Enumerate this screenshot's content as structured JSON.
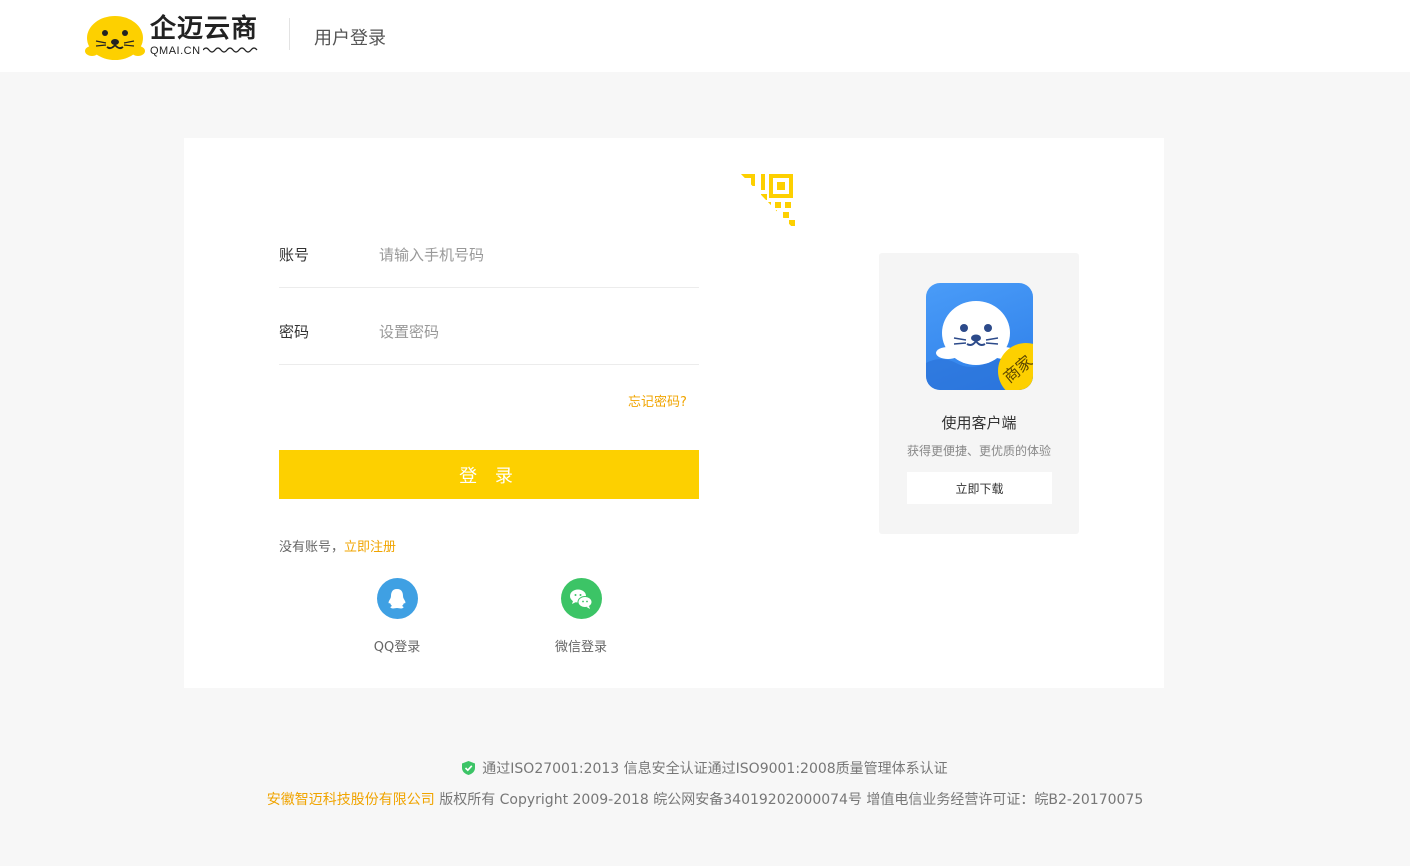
{
  "header": {
    "logo_cn": "企迈云商",
    "logo_en": "QMAI.CN",
    "title": "用户登录"
  },
  "form": {
    "account_label": "账号",
    "account_placeholder": "请输入手机号码",
    "password_label": "密码",
    "password_placeholder": "设置密码",
    "forgot": "忘记密码?",
    "login_button": "登 录",
    "no_account": "没有账号，",
    "register": "立即注册"
  },
  "social": {
    "qq": "QQ登录",
    "wechat": "微信登录"
  },
  "app": {
    "badge": "商家",
    "title": "使用客户端",
    "subtitle": "获得更便捷、更优质的体验",
    "download": "立即下载"
  },
  "footer": {
    "cert": "通过ISO27001:2013 信息安全认证通过ISO9001:2008质量管理体系认证",
    "company": "安徽智迈科技股份有限公司",
    "copyright": " 版权所有 Copyright 2009-2018 皖公网安备34019202000074号  增值电信业务经营许可证：皖B2-20170075"
  },
  "colors": {
    "accent": "#fdd000",
    "link": "#f0a400",
    "qq": "#3fa0e3",
    "wechat": "#3cc466",
    "app_blue": "#2c7de8"
  }
}
